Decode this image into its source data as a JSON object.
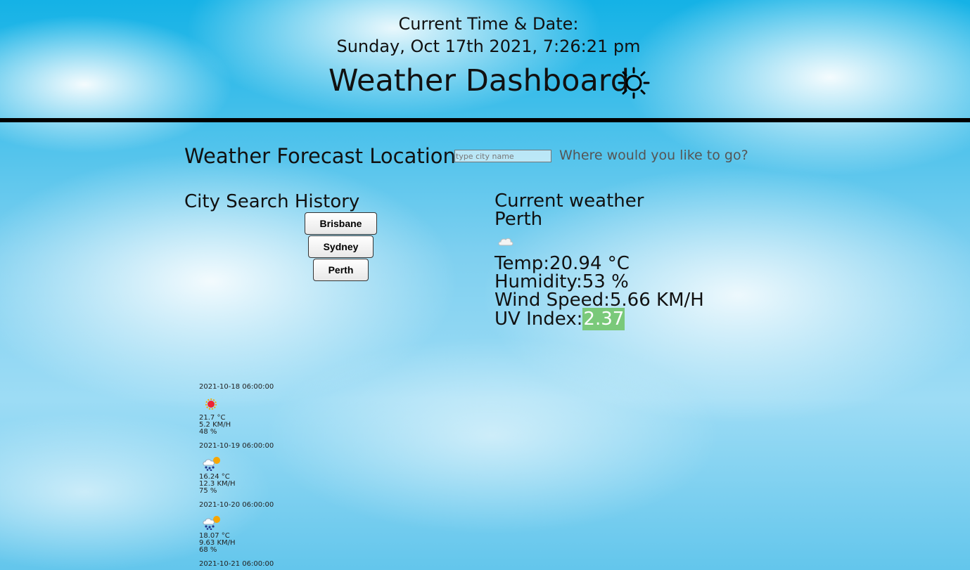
{
  "header": {
    "time_label": "Current Time & Date:",
    "time_value": "Sunday, Oct 17th 2021, 7:26:21 pm",
    "title": "Weather Dashboard"
  },
  "search": {
    "label": "Weather Forecast Location",
    "placeholder": "type city name",
    "hint": "Where would you like to go?"
  },
  "history": {
    "title": "City Search History",
    "cities": [
      "Brisbane",
      "Sydney",
      "Perth"
    ]
  },
  "current": {
    "title": "Current weather",
    "city": "Perth",
    "icon": "cloud-icon",
    "temp": "Temp:20.94 °C",
    "humidity": "Humidity:53 %",
    "wind": "Wind Speed:5.66 KM/H",
    "uv_label": "UV Index:",
    "uv_value": "2.37",
    "uv_color": "#7ac97a"
  },
  "forecast": [
    {
      "date": "2021-10-18 06:00:00",
      "icon": "sun-icon",
      "temp": "21.7 °C",
      "wind": "5.2 KM/H",
      "humidity": "48 %"
    },
    {
      "date": "2021-10-19 06:00:00",
      "icon": "snow-cloud-sun-icon",
      "temp": "16.24 °C",
      "wind": "12.3 KM/H",
      "humidity": "75 %"
    },
    {
      "date": "2021-10-20 06:00:00",
      "icon": "snow-cloud-sun-icon",
      "temp": "18.07 °C",
      "wind": "9.63 KM/H",
      "humidity": "68 %"
    },
    {
      "date": "2021-10-21 06:00:00"
    }
  ]
}
